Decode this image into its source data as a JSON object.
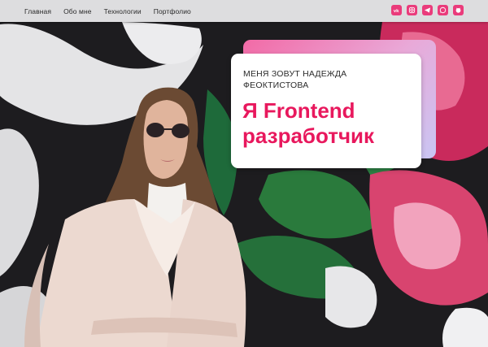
{
  "nav": {
    "items": [
      {
        "label": "Главная"
      },
      {
        "label": "Обо мне"
      },
      {
        "label": "Технологии"
      },
      {
        "label": "Портфолио"
      }
    ]
  },
  "socials": [
    {
      "name": "vk-icon"
    },
    {
      "name": "instagram-icon"
    },
    {
      "name": "telegram-icon"
    },
    {
      "name": "whatsapp-icon"
    },
    {
      "name": "github-icon"
    }
  ],
  "hero": {
    "subtitle": "МЕНЯ ЗОВУТ НАДЕЖДА ФЕОКТИСТОВА",
    "title": "Я Frontend разработчик"
  },
  "colors": {
    "accent": "#e8185d",
    "social_bg": "#ea3b7b"
  }
}
